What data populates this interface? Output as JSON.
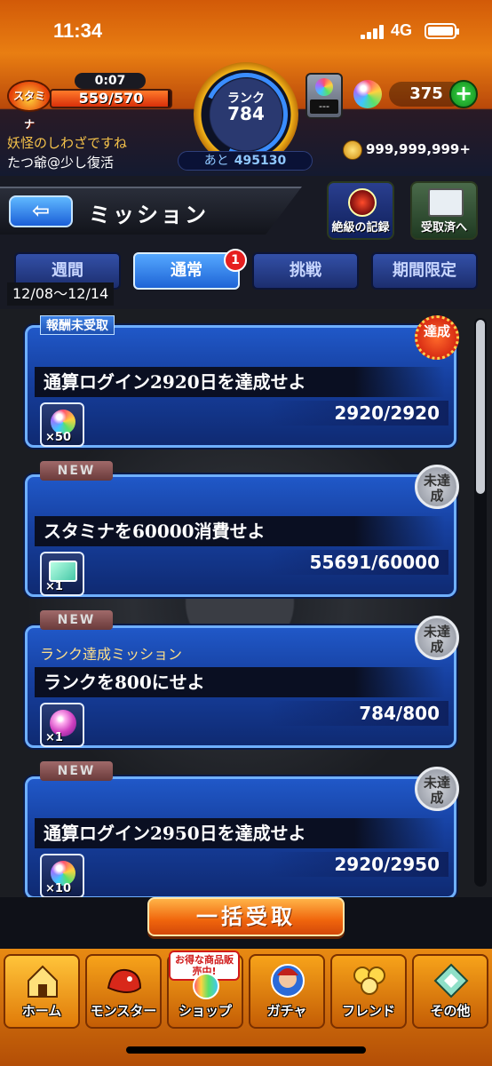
{
  "status_bar": {
    "time": "11:34",
    "network": "4G"
  },
  "header": {
    "stamina_label": "スタミナ",
    "stamina_timer": "0:07",
    "stamina_text": "559/570",
    "stamina_fraction": 0.981,
    "rank_label": "ランク",
    "rank_value": "784",
    "rank_next_label": "あと",
    "rank_next_value": "495130",
    "item_slot_text": "---",
    "orb_count": "375",
    "orb_add": "+",
    "user_status": "妖怪のしわざですね",
    "user_name": "たつ爺@少し復活",
    "gold": "999,999,999+"
  },
  "title_bar": {
    "back": "⇦",
    "title": "ミッション",
    "record_button": "絶級の記録",
    "received_button": "受取済へ"
  },
  "tabs": {
    "items": [
      {
        "label": "週間"
      },
      {
        "label": "通常"
      },
      {
        "label": "挑戦"
      },
      {
        "label": "期間限定"
      }
    ],
    "active_index": 1,
    "badge": "1",
    "week_range": "12/08〜12/14"
  },
  "missions": [
    {
      "tag": "報酬未受取",
      "category": "",
      "title": "通算ログイン2920日を達成せよ",
      "progress": "2920/2920",
      "reward_icon": "rainbow-orb-icon",
      "reward_qty": "×50",
      "stamp": "達成"
    },
    {
      "tag": "NEW",
      "category": "",
      "title": "スタミナを60000消費せよ",
      "progress": "55691/60000",
      "reward_icon": "ticket-icon",
      "reward_qty": "×1",
      "stamp": "未達成"
    },
    {
      "tag": "NEW",
      "category": "ランク達成ミッション",
      "title": "ランクを800にせよ",
      "progress": "784/800",
      "reward_icon": "pink-orb-icon",
      "reward_qty": "×1",
      "stamp": "未達成"
    },
    {
      "tag": "NEW",
      "category": "",
      "title": "通算ログイン2950日を達成せよ",
      "progress": "2920/2950",
      "reward_icon": "rainbow-orb-icon",
      "reward_qty": "×10",
      "stamp": "未達成"
    }
  ],
  "claim_all": "一括受取",
  "bottom_nav": {
    "items": [
      {
        "label": "ホーム"
      },
      {
        "label": "モンスター"
      },
      {
        "label": "ショップ",
        "promo": "お得な商品販売中!"
      },
      {
        "label": "ガチャ"
      },
      {
        "label": "フレンド"
      },
      {
        "label": "その他"
      }
    ]
  },
  "colors": {
    "header_orange": "#e97e12",
    "card_blue": "#1a4cb8",
    "accent_blue": "#55a8ff",
    "achieved_red": "#c9150c",
    "claim_orange": "#f0650c"
  }
}
